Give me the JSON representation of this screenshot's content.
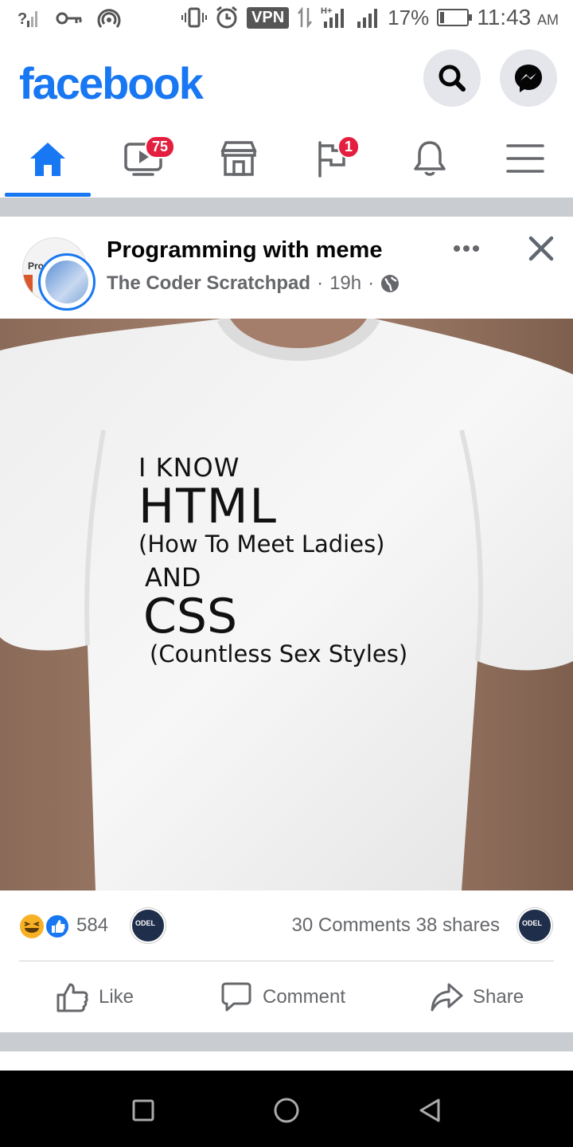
{
  "status_bar": {
    "battery_percent": "17%",
    "battery_level": 0.17,
    "time": "11:43",
    "ampm": "AM",
    "vpn_label": "VPN",
    "icons": [
      "signal-question-icon",
      "key-icon",
      "hotspot-icon",
      "vibrate-icon",
      "alarm-icon",
      "vpn-icon",
      "data-transfer-icon",
      "h-plus-signal-icon",
      "signal-icon"
    ]
  },
  "header": {
    "logo": "facebook",
    "search_icon": "search-icon",
    "messenger_icon": "messenger-icon"
  },
  "tabs": [
    {
      "name": "home",
      "icon": "home-icon",
      "badge": "",
      "active": true
    },
    {
      "name": "watch",
      "icon": "video-icon",
      "badge": "75",
      "active": false
    },
    {
      "name": "marketplace",
      "icon": "store-icon",
      "badge": "",
      "active": false
    },
    {
      "name": "pages",
      "icon": "flag-icon",
      "badge": "1",
      "active": false
    },
    {
      "name": "notifications",
      "icon": "bell-icon",
      "badge": "",
      "active": false
    },
    {
      "name": "menu",
      "icon": "menu-icon",
      "badge": "",
      "active": false
    }
  ],
  "post": {
    "group_name": "Programming with meme",
    "avatar_text": "Pro",
    "author": "The Coder Scratchpad",
    "time": "19h",
    "separator": "·",
    "privacy_icon": "globe-icon",
    "shirt_lines": [
      "I KNOW",
      "HTML",
      "(How To Meet Ladies)",
      "AND",
      "CSS",
      "(Countless Sex Styles)"
    ],
    "reaction_count": "584",
    "comments": "30 Comments",
    "shares": "38 shares",
    "mini_avatar_text": "ODEL",
    "actions": {
      "like": "Like",
      "comment": "Comment",
      "share": "Share"
    }
  },
  "colors": {
    "brand": "#1877f2",
    "badge": "#e41e3f",
    "separator": "#c9ccd1"
  }
}
